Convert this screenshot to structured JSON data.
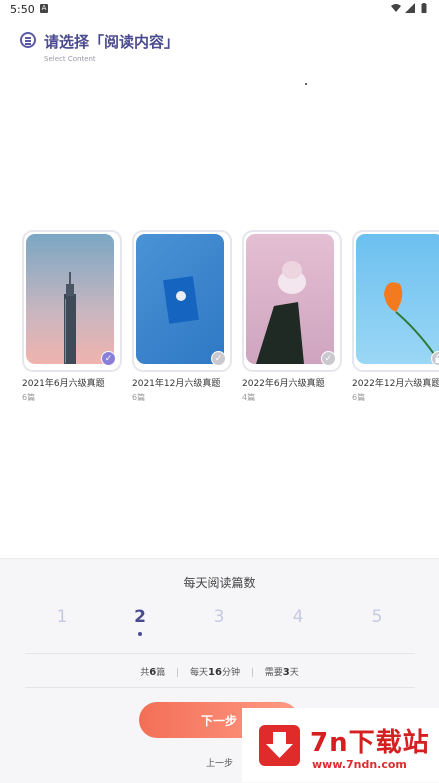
{
  "status_bar": {
    "time": "5:50",
    "a_icon": "A"
  },
  "header": {
    "menu_icon": "menu-circle-icon",
    "title": "请选择「阅读内容」",
    "subtitle": "Select Content"
  },
  "cards": [
    {
      "title": "2021年6月六级真题",
      "count": "6篇",
      "selected": true,
      "icon": "check-icon",
      "image": "skyscraper"
    },
    {
      "title": "2021年12月六级真题",
      "count": "6篇",
      "selected": false,
      "icon": "check-icon",
      "image": "blue-notebook"
    },
    {
      "title": "2022年6月六级真题",
      "count": "4篇",
      "selected": false,
      "icon": "check-icon",
      "image": "hand-earbuds"
    },
    {
      "title": "2022年12月六级真题",
      "count": "6篇",
      "selected": false,
      "icon": "lock-icon",
      "image": "orange-flower"
    }
  ],
  "panel": {
    "title": "每天阅读篇数",
    "numbers": [
      "1",
      "2",
      "3",
      "4",
      "5"
    ],
    "selected_number": "2",
    "stats": {
      "total_prefix": "共",
      "total_value": "6",
      "total_unit": "篇",
      "daily_prefix": "每天",
      "daily_value": "16",
      "daily_unit": "分钟",
      "need_prefix": "需要",
      "need_value": "3",
      "need_unit": "天"
    },
    "next_label": "下一步",
    "prev_label": "上一步"
  },
  "watermark": {
    "big": "7n下载站",
    "small": "www.7ndn.com"
  },
  "colors": {
    "accent": "#4b4b8f",
    "button": "#f36f57",
    "check_on": "#8a7fd8"
  }
}
